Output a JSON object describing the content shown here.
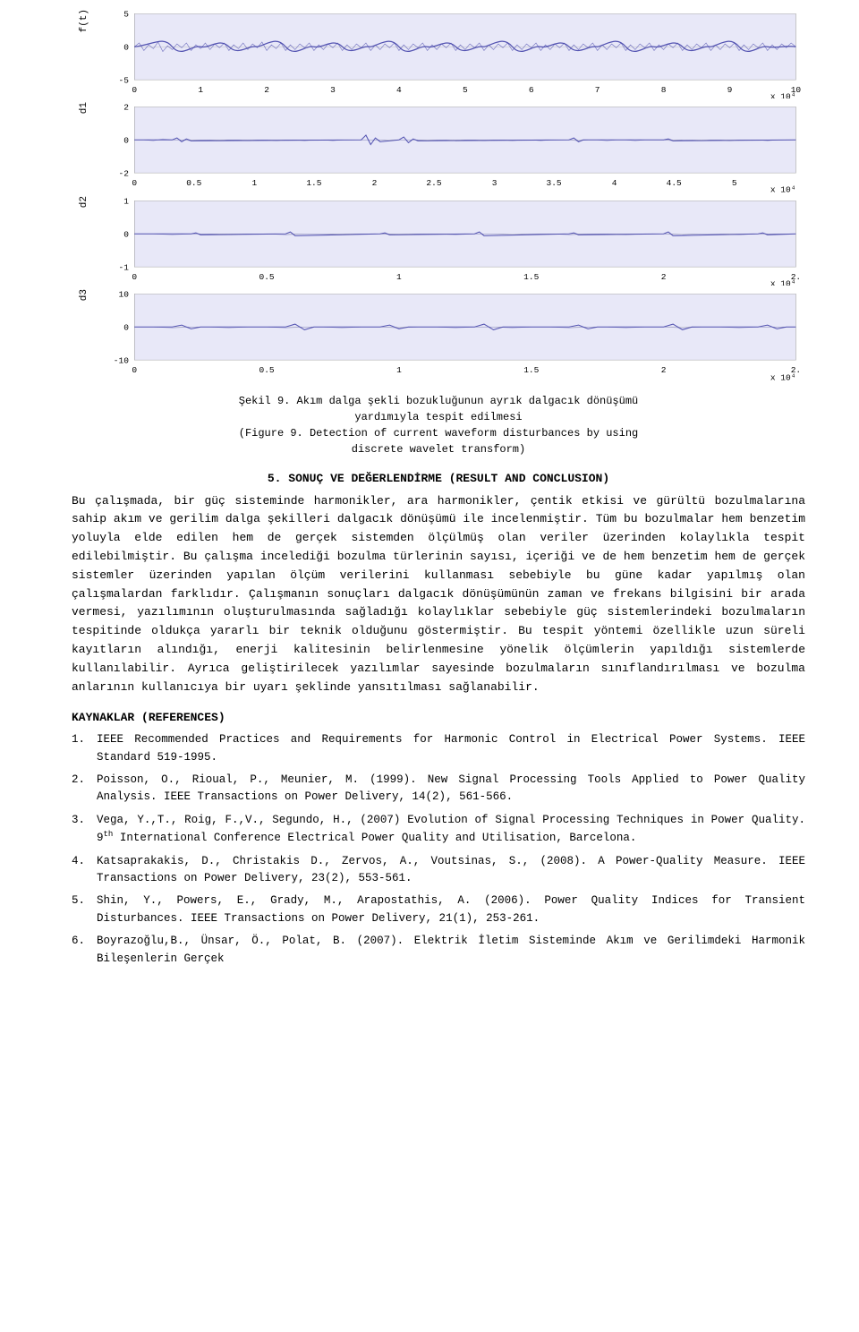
{
  "charts": [
    {
      "id": "chart1",
      "ylabel": "f(t)",
      "yticks": [
        "5",
        "0",
        "-5"
      ],
      "xticks": [
        "0",
        "1",
        "2",
        "3",
        "4",
        "5",
        "6",
        "7",
        "8",
        "9",
        "10"
      ],
      "xscale": "x 10⁴",
      "signal_color": "#6666cc",
      "bg_color": "#eeeeff"
    },
    {
      "id": "chart2",
      "ylabel": "d1",
      "yticks": [
        "2",
        "0",
        "-2"
      ],
      "xticks": [
        "0",
        "0.5",
        "1",
        "1.5",
        "2",
        "2.5",
        "3",
        "3.5",
        "4",
        "4.5",
        "5"
      ],
      "xscale": "x 10⁴",
      "signal_color": "#6666cc",
      "bg_color": "#eeeeff"
    },
    {
      "id": "chart3",
      "ylabel": "d2",
      "yticks": [
        "1",
        "0",
        "-1"
      ],
      "xticks": [
        "0",
        "0.5",
        "1",
        "1.5",
        "2",
        "2."
      ],
      "xscale": "x 10⁴",
      "signal_color": "#6666cc",
      "bg_color": "#eeeeff"
    },
    {
      "id": "chart4",
      "ylabel": "d3",
      "yticks": [
        "10",
        "0",
        "-10"
      ],
      "xticks": [
        "0",
        "0.5",
        "1",
        "1.5",
        "2",
        "2."
      ],
      "xscale": "x 10⁴",
      "signal_color": "#6666cc",
      "bg_color": "#eeeeff"
    }
  ],
  "figure_caption": {
    "line1": "Şekil 9. Akım dalga şekli bozukluğunun ayrık dalgacık dönüşümü",
    "line2": "yardımıyla tespit edilmesi",
    "line3": "(Figure 9. Detection of current waveform disturbances by using",
    "line4": "discrete wavelet transform)"
  },
  "section": {
    "heading": "5. SONUÇ VE DEĞERLENDİRME (RESULT AND CONCLUSION)",
    "paragraphs": [
      "   Bu çalışmada, bir güç sisteminde harmonikler, ara harmonikler, çentik etkisi ve gürültü bozulmalarına sahip akım ve gerilim dalga şekilleri dalgacık dönüşümü ile incelenmiştir. Tüm bu bozulmalar hem benzetim yoluyla elde edilen hem de gerçek sistemden ölçülmüş olan veriler üzerinden kolaylıkla tespit edilebilmiştir. Bu çalışma incelediği bozulma türlerinin sayısı, içeriği ve de hem benzetim hem de gerçek sistemler üzerinden yapılan ölçüm verilerini kullanması sebebiyle bu güne kadar yapılmış olan çalışmalardan farklıdır. Çalışmanın sonuçları dalgacık dönüşümünün zaman ve frekans bilgisini bir arada vermesi, yazılımının oluşturulmasında sağladığı kolaylıklar sebebiyle güç sistemlerindeki bozulmaların tespitinde oldukça yararlı bir teknik olduğunu göstermiştir. Bu tespit yöntemi özellikle uzun süreli kayıtların alındığı, enerji kalitesinin belirlenmesine yönelik ölçümlerin yapıldığı sistemlerde kullanılabilir. Ayrıca geliştirilecek yazılımlar sayesinde bozulmaların sınıflandırılması ve bozulma anlarının kullanıcıya bir uyarı şeklinde yansıtılması sağlanabilir."
    ]
  },
  "references": {
    "heading": "KAYNAKLAR (REFERENCES)",
    "items": [
      {
        "num": "1.",
        "text": "IEEE Recommended Practices and Requirements for Harmonic Control in Electrical Power Systems. IEEE Standard 519-1995."
      },
      {
        "num": "2.",
        "text": "Poisson, O., Rioual, P., Meunier, M. (1999). New Signal Processing Tools Applied to Power Quality Analysis. IEEE Transactions on Power Delivery, 14(2), 561-566."
      },
      {
        "num": "3.",
        "text": "Vega, Y.,T., Roig, F.,V., Segundo, H., (2007) Evolution of Signal Processing Techniques in Power Quality. 9th International Conference Electrical Power Quality and Utilisation, Barcelona."
      },
      {
        "num": "4.",
        "text": "Katsaprakakis, D., Christakis D., Zervos, A., Voutsinas, S., (2008). A Power-Quality Measure. IEEE Transactions on Power Delivery, 23(2), 553-561."
      },
      {
        "num": "5.",
        "text": "Shin, Y., Powers, E., Grady, M., Arapostathis, A. (2006). Power Quality Indices for Transient Disturbances. IEEE Transactions on Power Delivery, 21(1), 253-261."
      },
      {
        "num": "6.",
        "text": "Boyrazoğlu,B., Ünsar, Ö., Polat, B. (2007). Elektrik İletim Sisteminde Akım ve Gerilimdeki Harmonik Bileşenlerin Gerçek"
      }
    ]
  }
}
